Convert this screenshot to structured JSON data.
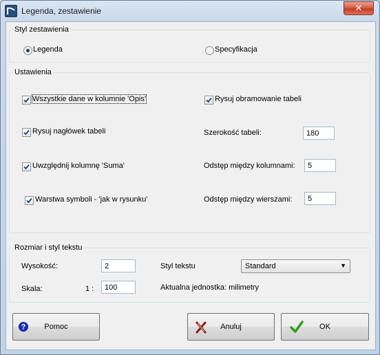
{
  "window": {
    "title": "Legenda, zestawienie",
    "close_glyph": "✕"
  },
  "styl_group": {
    "legend": "Styl zestawienia",
    "options": [
      {
        "label": "Legenda",
        "checked": true
      },
      {
        "label": "Specyfikacja",
        "checked": false
      }
    ]
  },
  "ustawienia": {
    "legend": "Ustawienia",
    "checkboxes": [
      {
        "label": "Wszystkie dane w kolumnie 'Opis'",
        "checked": true
      },
      {
        "label": "Rysuj nagłówek tabeli",
        "checked": true
      },
      {
        "label": "Uwzględnij kolumnę 'Suma'",
        "checked": true
      },
      {
        "label": "Warstwa symboli - 'jak w rysunku'",
        "checked": true
      },
      {
        "label": "Rysuj obramowanie tabeli",
        "checked": true
      }
    ],
    "fields": [
      {
        "label": "Szerokość tabeli:",
        "value": "180"
      },
      {
        "label": "Odstęp między kolumnami:",
        "value": "5"
      },
      {
        "label": "Odstęp między wierszami:",
        "value": "5"
      }
    ]
  },
  "rozmiar": {
    "legend": "Rozmiar i styl tekstu",
    "wysokosc_label": "Wysokość:",
    "wysokosc_value": "2",
    "skala_label": "Skala:",
    "skala_prefix": "1 :",
    "skala_value": "100",
    "styl_label": "Styl tekstu",
    "styl_value": "Standard",
    "unit_text": "Aktualna jednostka: milimetry"
  },
  "buttons": {
    "help": "Pomoc",
    "cancel": "Anuluj",
    "ok": "OK"
  },
  "colors": {
    "check": "#1e3f86",
    "help_icon": "#1a2fa8",
    "cancel_icon": "#8b1a1a",
    "ok_icon": "#2f9b18"
  }
}
